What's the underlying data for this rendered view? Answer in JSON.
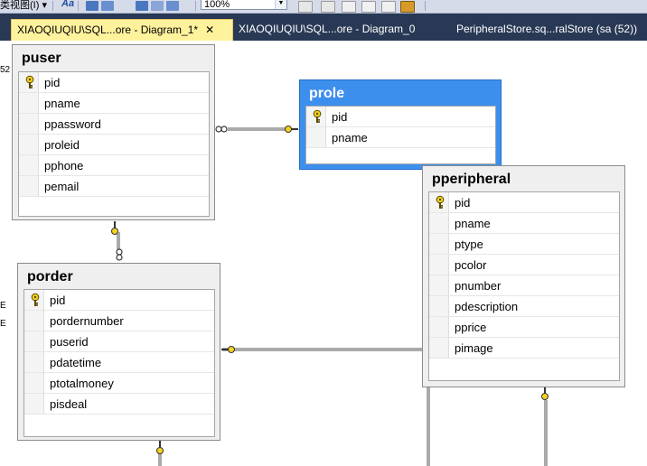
{
  "toolbar": {
    "menu_fragment": "类视图(I) ▾",
    "font_button": "Aa",
    "zoom_value": "100%"
  },
  "tabs": [
    {
      "label": "XIAOQIUQIU\\SQL...ore - Diagram_1*",
      "close": "✕",
      "active": true
    },
    {
      "label": "XIAOQIUQIU\\SQL...ore - Diagram_0",
      "active": false
    },
    {
      "label": "PeripheralStore.sq...ralStore (sa (52))",
      "active": false
    }
  ],
  "side_fragments": [
    "52",
    "E",
    "E"
  ],
  "tables": {
    "puser": {
      "title": "puser",
      "columns": [
        {
          "name": "pid",
          "pk": true
        },
        {
          "name": "pname",
          "pk": false
        },
        {
          "name": "ppassword",
          "pk": false
        },
        {
          "name": "proleid",
          "pk": false
        },
        {
          "name": "pphone",
          "pk": false
        },
        {
          "name": "pemail",
          "pk": false
        }
      ]
    },
    "prole": {
      "title": "prole",
      "selected": true,
      "columns": [
        {
          "name": "pid",
          "pk": true
        },
        {
          "name": "pname",
          "pk": false
        }
      ]
    },
    "pperipheral": {
      "title": "pperipheral",
      "columns": [
        {
          "name": "pid",
          "pk": true
        },
        {
          "name": "pname",
          "pk": false
        },
        {
          "name": "ptype",
          "pk": false
        },
        {
          "name": "pcolor",
          "pk": false
        },
        {
          "name": "pnumber",
          "pk": false
        },
        {
          "name": "pdescription",
          "pk": false
        },
        {
          "name": "pprice",
          "pk": false
        },
        {
          "name": "pimage",
          "pk": false
        }
      ]
    },
    "porder": {
      "title": "porder",
      "columns": [
        {
          "name": "pid",
          "pk": true
        },
        {
          "name": "pordernumber",
          "pk": false
        },
        {
          "name": "puserid",
          "pk": false
        },
        {
          "name": "pdatetime",
          "pk": false
        },
        {
          "name": "ptotalmoney",
          "pk": false
        },
        {
          "name": "pisdeal",
          "pk": false
        }
      ]
    }
  },
  "colors": {
    "tab_strip": "#293955",
    "active_tab": "#fff29d",
    "selected_table": "#3d8fee",
    "table_background": "#efefef",
    "key_icon": "#f5d21f"
  },
  "icons": {
    "primary_key": "key-icon",
    "relationship_one_end": "key-icon",
    "relationship_many_end": "infinity-icon"
  }
}
